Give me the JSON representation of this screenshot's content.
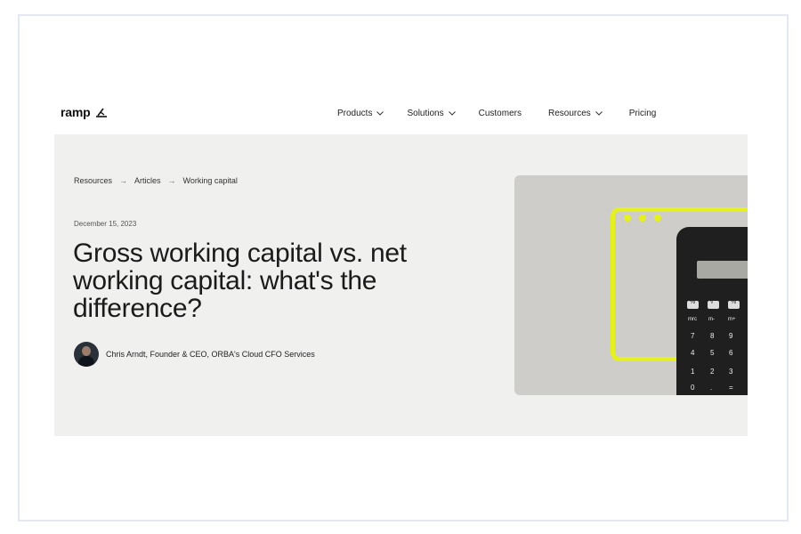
{
  "brand": {
    "name": "ramp"
  },
  "nav": {
    "items": [
      {
        "label": "Products",
        "has_dropdown": true
      },
      {
        "label": "Solutions",
        "has_dropdown": true
      },
      {
        "label": "Customers",
        "has_dropdown": false
      },
      {
        "label": "Resources",
        "has_dropdown": true
      },
      {
        "label": "Pricing",
        "has_dropdown": false
      }
    ]
  },
  "breadcrumb": [
    "Resources",
    "Articles",
    "Working capital"
  ],
  "article": {
    "date": "December 15, 2023",
    "title": "Gross working capital vs. net working capital: what's the difference?",
    "author": "Chris Arndt, Founder & CEO, ORBA's Cloud CFO Services"
  },
  "calculator_keys": [
    "%",
    "√",
    "%",
    "mrc",
    "m-",
    "m+",
    "7",
    "8",
    "9",
    "4",
    "5",
    "6",
    "1",
    "2",
    "3",
    "0",
    ".",
    "="
  ],
  "colors": {
    "hero_bg": "#f0f0ef",
    "accent_yellow": "#e5f020",
    "frame_border": "#e3e8f4"
  }
}
